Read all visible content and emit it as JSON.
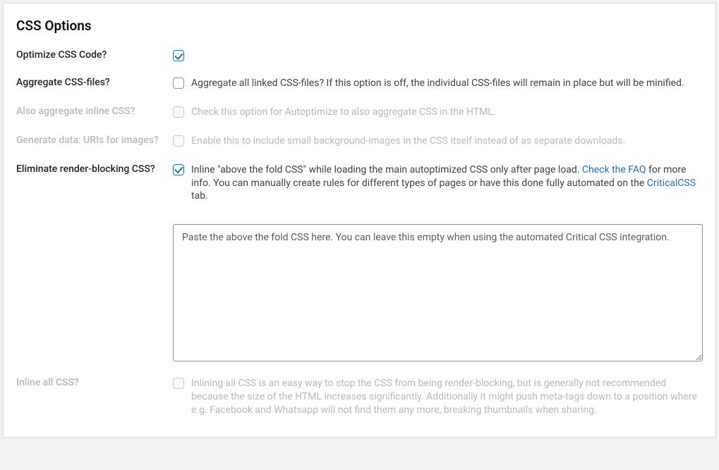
{
  "panel": {
    "title": "CSS Options"
  },
  "rows": {
    "optimize": {
      "label": "Optimize CSS Code?"
    },
    "aggregate": {
      "label": "Aggregate CSS-files?",
      "desc": "Aggregate all linked CSS-files? If this option is off, the individual CSS-files will remain in place but will be minified."
    },
    "inline_agg": {
      "label": "Also aggregate inline CSS?",
      "desc": "Check this option for Autoptimize to also aggregate CSS in the HTML."
    },
    "datauris": {
      "label": "Generate data: URIs for images?",
      "desc": "Enable this to include small background-images in the CSS itself instead of as separate downloads."
    },
    "eliminate": {
      "label": "Eliminate render-blocking CSS?",
      "desc_1": "Inline \"above the fold CSS\" while loading the main autoptimized CSS only after page load. ",
      "link1": "Check the FAQ",
      "desc_2": " for more info. You can manually create rules for different types of pages or have this done fully automated on the ",
      "link2": "CriticalCSS",
      "desc_3": " tab.",
      "placeholder": "Paste the above the fold CSS here. You can leave this empty when using the automated Critical CSS integration."
    },
    "inline_all": {
      "label": "Inline all CSS?",
      "desc": "Inlining all CSS is an easy way to stop the CSS from being render-blocking, but is generally not recommended because the size of the HTML increases significantly. Additionally it might push meta-tags down to a position where e.g. Facebook and Whatsapp will not find them any more, breaking thumbnails when sharing."
    }
  }
}
